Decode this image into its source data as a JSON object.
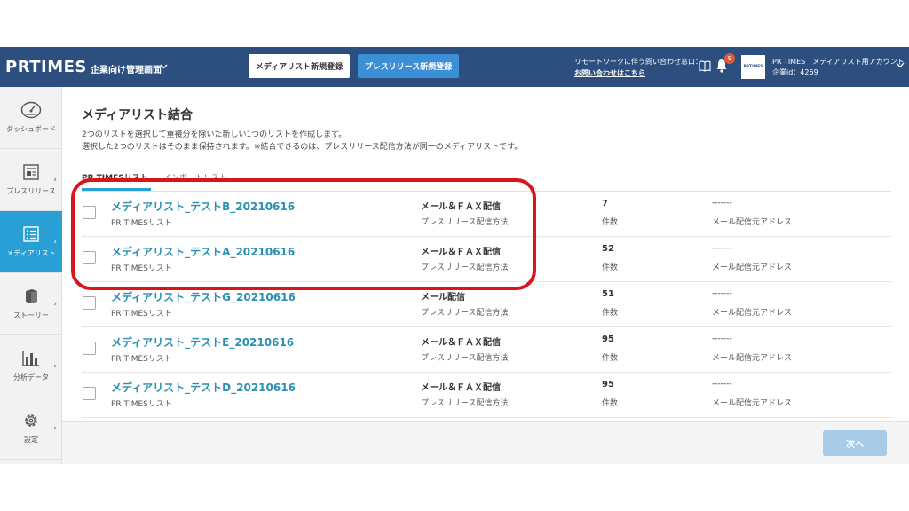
{
  "header": {
    "logo": "PRTIMES",
    "admin_label": "企業向け管理画面",
    "new_media_list_button": "メディアリスト新規登録",
    "new_press_release_button": "プレスリリース新規登録",
    "remote_notice": "リモートワークに伴う問い合わせ窓口：",
    "contact_link": "お問い合わせはこちら",
    "notification_count": "9",
    "account_logo_text": "PRTIMES",
    "account_name": "PR TIMES　メディアリスト用アカウント",
    "account_id": "企業id：4269"
  },
  "sidebar": {
    "items": [
      {
        "label": "ダッシュボード",
        "icon": "dashboard-icon"
      },
      {
        "label": "プレスリリース",
        "icon": "press-release-icon"
      },
      {
        "label": "メディアリスト",
        "icon": "media-list-icon",
        "active": true
      },
      {
        "label": "ストーリー",
        "icon": "book-icon"
      },
      {
        "label": "分析データ",
        "icon": "bar-chart-icon"
      },
      {
        "label": "設定",
        "icon": "gear-icon"
      }
    ]
  },
  "main": {
    "title": "メディアリスト結合",
    "description_1": "2つのリストを選択して重複分を除いた新しい1つのリストを作成します。",
    "description_2": "選択した2つのリストはそのまま保持されます。※結合できるのは、プレスリリース配信方法が同一のメディアリストです。",
    "tabs": [
      {
        "label": "PR TIMESリスト",
        "active": true
      },
      {
        "label": "インポートリスト",
        "active": false
      }
    ],
    "rows": [
      {
        "name": "メディアリスト_テストB_20210616",
        "type": "PR TIMESリスト",
        "method": "メール＆ＦＡＸ配信",
        "method_label": "プレスリリース配信方法",
        "count": "7",
        "count_label": "件数",
        "email": "-------",
        "email_label": "メール配信元アドレス"
      },
      {
        "name": "メディアリスト_テストA_20210616",
        "type": "PR TIMESリスト",
        "method": "メール＆ＦＡＸ配信",
        "method_label": "プレスリリース配信方法",
        "count": "52",
        "count_label": "件数",
        "email": "-------",
        "email_label": "メール配信元アドレス"
      },
      {
        "name": "メディアリスト_テストG_20210616",
        "type": "PR TIMESリスト",
        "method": "メール配信",
        "method_label": "プレスリリース配信方法",
        "count": "51",
        "count_label": "件数",
        "email": "-------",
        "email_label": "メール配信元アドレス"
      },
      {
        "name": "メディアリスト_テストE_20210616",
        "type": "PR TIMESリスト",
        "method": "メール＆ＦＡＸ配信",
        "method_label": "プレスリリース配信方法",
        "count": "95",
        "count_label": "件数",
        "email": "-------",
        "email_label": "メール配信元アドレス"
      },
      {
        "name": "メディアリスト_テストD_20210616",
        "type": "PR TIMESリスト",
        "method": "メール＆ＦＡＸ配信",
        "method_label": "プレスリリース配信方法",
        "count": "95",
        "count_label": "件数",
        "email": "-------",
        "email_label": "メール配信元アドレス"
      }
    ]
  },
  "footer": {
    "next_button": "次へ"
  },
  "colors": {
    "header_bg": "#2d4f80",
    "accent": "#2a9fd6",
    "highlight": "#d9141b"
  }
}
